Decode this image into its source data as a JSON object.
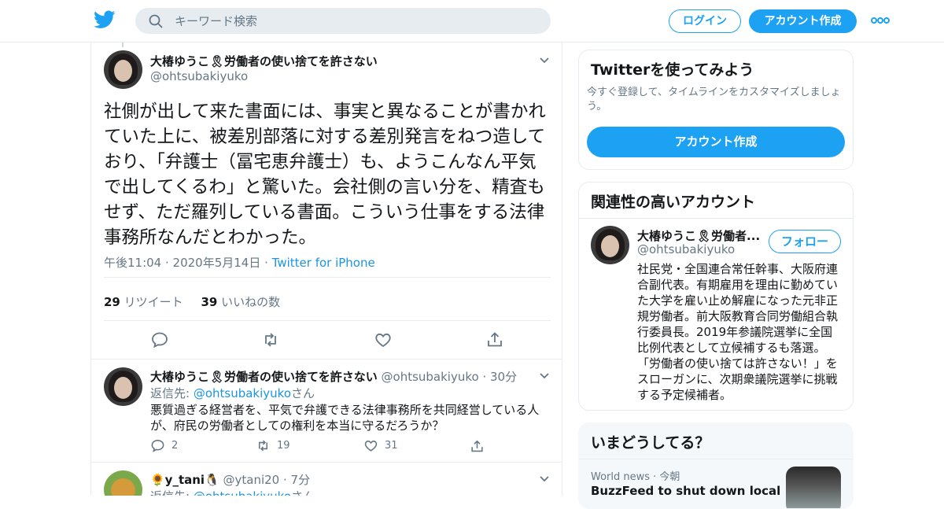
{
  "header": {
    "search_placeholder": "キーワード検索",
    "login_label": "ログイン",
    "signup_label": "アカウント作成"
  },
  "focus_tweet": {
    "name": "大椿ゆうこ🎗労働者の使い捨てを許さない",
    "handle": "@ohtsubakiyuko",
    "text": "社側が出して来た書面には、事実と異なることが書かれていた上に、被差別部落に対する差別発言をねつ造しており、「弁護士（冨宅恵弁護士）も、ようこんなん平気で出してくるわ」と驚いた。会社側の言い分を、精査もせず、ただ羅列している書面。こういう仕事をする法律事務所なんだとわかった。",
    "time": "午後11:04 · 2020年5月14日 · ",
    "client": "Twitter for iPhone",
    "retweets": "29",
    "retweets_label": " リツイート",
    "likes": "39",
    "likes_label": " いいねの数"
  },
  "replies": [
    {
      "name": "大椿ゆうこ🎗労働者の使い捨てを許さない",
      "handle_time": " @ohtsubakiyuko · 30分",
      "reply_to_prefix": "返信先: ",
      "reply_to_user": "@ohtsubakiyuko",
      "reply_to_suffix": "さん",
      "text": "悪質過ぎる経営者を、平気で弁護できる法律事務所を共同経営している人が、府民の労働者としての権利を本当に守るだろうか？",
      "replies": "2",
      "retweets": "19",
      "likes": "31"
    },
    {
      "name": "🌻y_tani🐧",
      "handle_time": " @ytani20 · 7分",
      "reply_to_prefix": "返信先: ",
      "reply_to_user": "@ohtsubakiyuko",
      "reply_to_suffix": "さん"
    }
  ],
  "signup_card": {
    "title": "Twitterを使ってみよう",
    "subtitle": "今すぐ登録して、タイムラインをカスタマイズしましょう。",
    "button": "アカウント作成"
  },
  "related_card": {
    "title": "関連性の高いアカウント",
    "name": "大椿ゆうこ🎗労働者...",
    "handle": "@ohtsubakiyuko",
    "follow_label": "フォロー",
    "bio": "社民党・全国連合常任幹事、大阪府連合副代表。有期雇用を理由に勤めていた大学を雇い止め解雇になった元非正規労働者。前大阪教育合同労働組合執行委員長。2019年参議院選挙に全国比例代表として立候補するも落選。「労働者の使い捨ては許さない！」をスローガンに、次期衆議院選挙に挑戦する予定候補者。"
  },
  "trends_card": {
    "title": "いまどうしてる？",
    "source": "World news · 今朝",
    "headline": "BuzzFeed to shut down local"
  },
  "colors": {
    "accent": "#1da1f2",
    "link": "#1b95e0",
    "muted": "#657786",
    "border": "#e6ecf0"
  }
}
